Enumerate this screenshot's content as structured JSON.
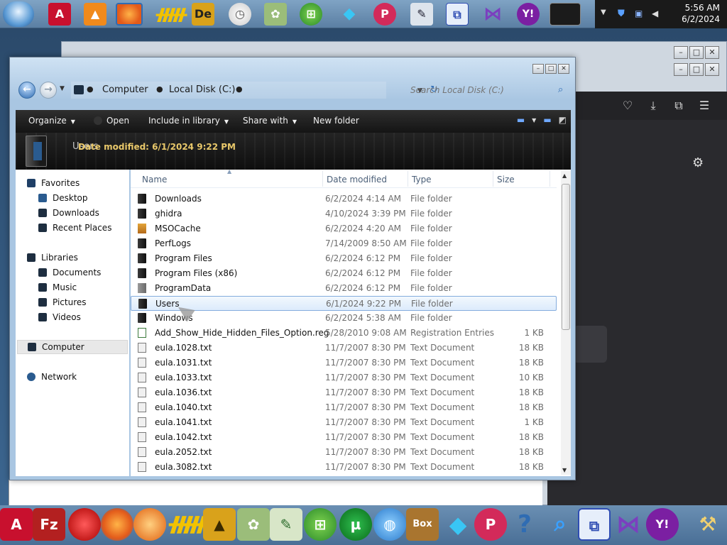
{
  "taskbar": {
    "clock_time": "5:56 AM",
    "clock_date": "6/2/2024",
    "top_icons": [
      "start-orb-icon",
      "acrobat-icon",
      "vlc-icon",
      "firefox-icon",
      "aim-icon",
      "photoshop-icon",
      "clock-icon",
      "flower-icon",
      "windows-icon",
      "gem-icon",
      "paint-icon",
      "pen-icon",
      "remote-icon",
      "visual-studio-icon",
      "yahoo-icon",
      "terminal-icon"
    ],
    "bottom_icons": [
      "acrobat-icon",
      "filezilla-icon",
      "red-ball-icon",
      "firefox-icon",
      "orange-ball-icon",
      "aim-icon",
      "box-icon",
      "flower-icon",
      "notepad-icon",
      "windows-icon",
      "utorrent-icon",
      "globe-icon",
      "virtualbox-icon",
      "gem-icon",
      "paint-icon",
      "help-icon",
      "search-icon",
      "remote-icon",
      "visual-studio-icon",
      "yahoo-icon",
      "tools-icon"
    ]
  },
  "explorer": {
    "breadcrumb": [
      "Computer",
      "Local Disk (C:)"
    ],
    "search_placeholder": "Search Local Disk (C:)",
    "toolbar": {
      "organize": "Organize",
      "open": "Open",
      "include": "Include in library",
      "share": "Share with",
      "new_folder": "New folder"
    },
    "details": {
      "name": "Users",
      "label": "Date modified:",
      "value": "6/1/2024 9:22 PM",
      "type": "File folder"
    },
    "nav": {
      "favorites": "Favorites",
      "desktop": "Desktop",
      "downloads": "Downloads",
      "recent": "Recent Places",
      "libraries": "Libraries",
      "documents": "Documents",
      "music": "Music",
      "pictures": "Pictures",
      "videos": "Videos",
      "computer": "Computer",
      "network": "Network"
    },
    "columns": {
      "name": "Name",
      "date": "Date modified",
      "type": "Type",
      "size": "Size"
    },
    "files": [
      {
        "name": "Downloads",
        "date": "6/2/2024 4:14 AM",
        "type": "File folder",
        "size": "",
        "icon": "folder-icon"
      },
      {
        "name": "ghidra",
        "date": "4/10/2024 3:39 PM",
        "type": "File folder",
        "size": "",
        "icon": "folder-icon"
      },
      {
        "name": "MSOCache",
        "date": "6/2/2024 4:20 AM",
        "type": "File folder",
        "size": "",
        "icon": "folder-icon"
      },
      {
        "name": "PerfLogs",
        "date": "7/14/2009 8:50 AM",
        "type": "File folder",
        "size": "",
        "icon": "folder-icon"
      },
      {
        "name": "Program Files",
        "date": "6/2/2024 6:12 PM",
        "type": "File folder",
        "size": "",
        "icon": "folder-icon"
      },
      {
        "name": "Program Files (x86)",
        "date": "6/2/2024 6:12 PM",
        "type": "File folder",
        "size": "",
        "icon": "folder-icon"
      },
      {
        "name": "ProgramData",
        "date": "6/2/2024 6:12 PM",
        "type": "File folder",
        "size": "",
        "icon": "folder-icon"
      },
      {
        "name": "Users",
        "date": "6/1/2024 9:22 PM",
        "type": "File folder",
        "size": "",
        "icon": "folder-icon"
      },
      {
        "name": "Windows",
        "date": "6/2/2024 5:38 AM",
        "type": "File folder",
        "size": "",
        "icon": "folder-icon"
      },
      {
        "name": "Add_Show_Hide_Hidden_Files_Option.reg",
        "date": "5/28/2010 9:08 AM",
        "type": "Registration Entries",
        "size": "1 KB",
        "icon": "registry-file-icon"
      },
      {
        "name": "eula.1028.txt",
        "date": "11/7/2007 8:30 PM",
        "type": "Text Document",
        "size": "18 KB",
        "icon": "text-file-icon"
      },
      {
        "name": "eula.1031.txt",
        "date": "11/7/2007 8:30 PM",
        "type": "Text Document",
        "size": "18 KB",
        "icon": "text-file-icon"
      },
      {
        "name": "eula.1033.txt",
        "date": "11/7/2007 8:30 PM",
        "type": "Text Document",
        "size": "10 KB",
        "icon": "text-file-icon"
      },
      {
        "name": "eula.1036.txt",
        "date": "11/7/2007 8:30 PM",
        "type": "Text Document",
        "size": "18 KB",
        "icon": "text-file-icon"
      },
      {
        "name": "eula.1040.txt",
        "date": "11/7/2007 8:30 PM",
        "type": "Text Document",
        "size": "18 KB",
        "icon": "text-file-icon"
      },
      {
        "name": "eula.1041.txt",
        "date": "11/7/2007 8:30 PM",
        "type": "Text Document",
        "size": "1 KB",
        "icon": "text-file-icon"
      },
      {
        "name": "eula.1042.txt",
        "date": "11/7/2007 8:30 PM",
        "type": "Text Document",
        "size": "18 KB",
        "icon": "text-file-icon"
      },
      {
        "name": "eula.2052.txt",
        "date": "11/7/2007 8:30 PM",
        "type": "Text Document",
        "size": "18 KB",
        "icon": "text-file-icon"
      },
      {
        "name": "eula.3082.txt",
        "date": "11/7/2007 8:30 PM",
        "type": "Text Document",
        "size": "18 KB",
        "icon": "text-file-icon"
      }
    ],
    "selected_index": 7
  }
}
